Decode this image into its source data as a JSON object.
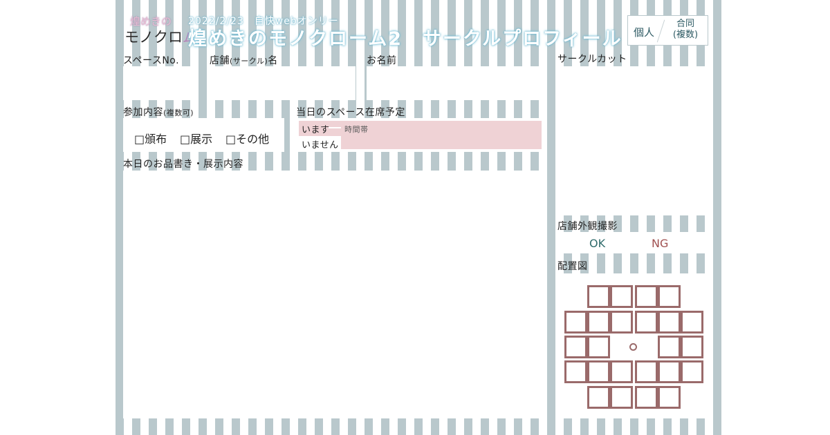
{
  "logo": {
    "top": "煌めきの",
    "bottom": "モノクロ",
    "bottom_accent": "ム2"
  },
  "header": {
    "subtitle": "2022/2/23　自快webオンリー",
    "title": "煌めきのモノクローム2　サークルプロフィール",
    "tag_single": "個人",
    "tag_joint_line1": "合同",
    "tag_joint_line2": "(複数)"
  },
  "fields": {
    "space_no": "スペースNo.",
    "shop_name_pre": "店舗",
    "shop_name_small": "(サークル)",
    "shop_name_post": "名",
    "your_name": "お名前",
    "participation": "参加内容",
    "participation_small": "(複数可)",
    "opt_distribute": "□頒布",
    "opt_exhibit": "□展示",
    "opt_other": "□その他",
    "presence": "当日のスペース在席予定",
    "present": "います",
    "time_slot": "時間帯",
    "absent": "いません",
    "menu": "本日のお品書き・展示内容",
    "circle_cut": "サークルカット",
    "photo": "店舗外観撮影",
    "ok": "OK",
    "ng": "NG",
    "layout_map": "配置図"
  },
  "colors": {
    "stripe": "#b9c8cc",
    "pink_fill": "#efd2d5",
    "map_stroke": "#9a6a6a",
    "ok": "#2f6b6b",
    "ng": "#a05050"
  }
}
